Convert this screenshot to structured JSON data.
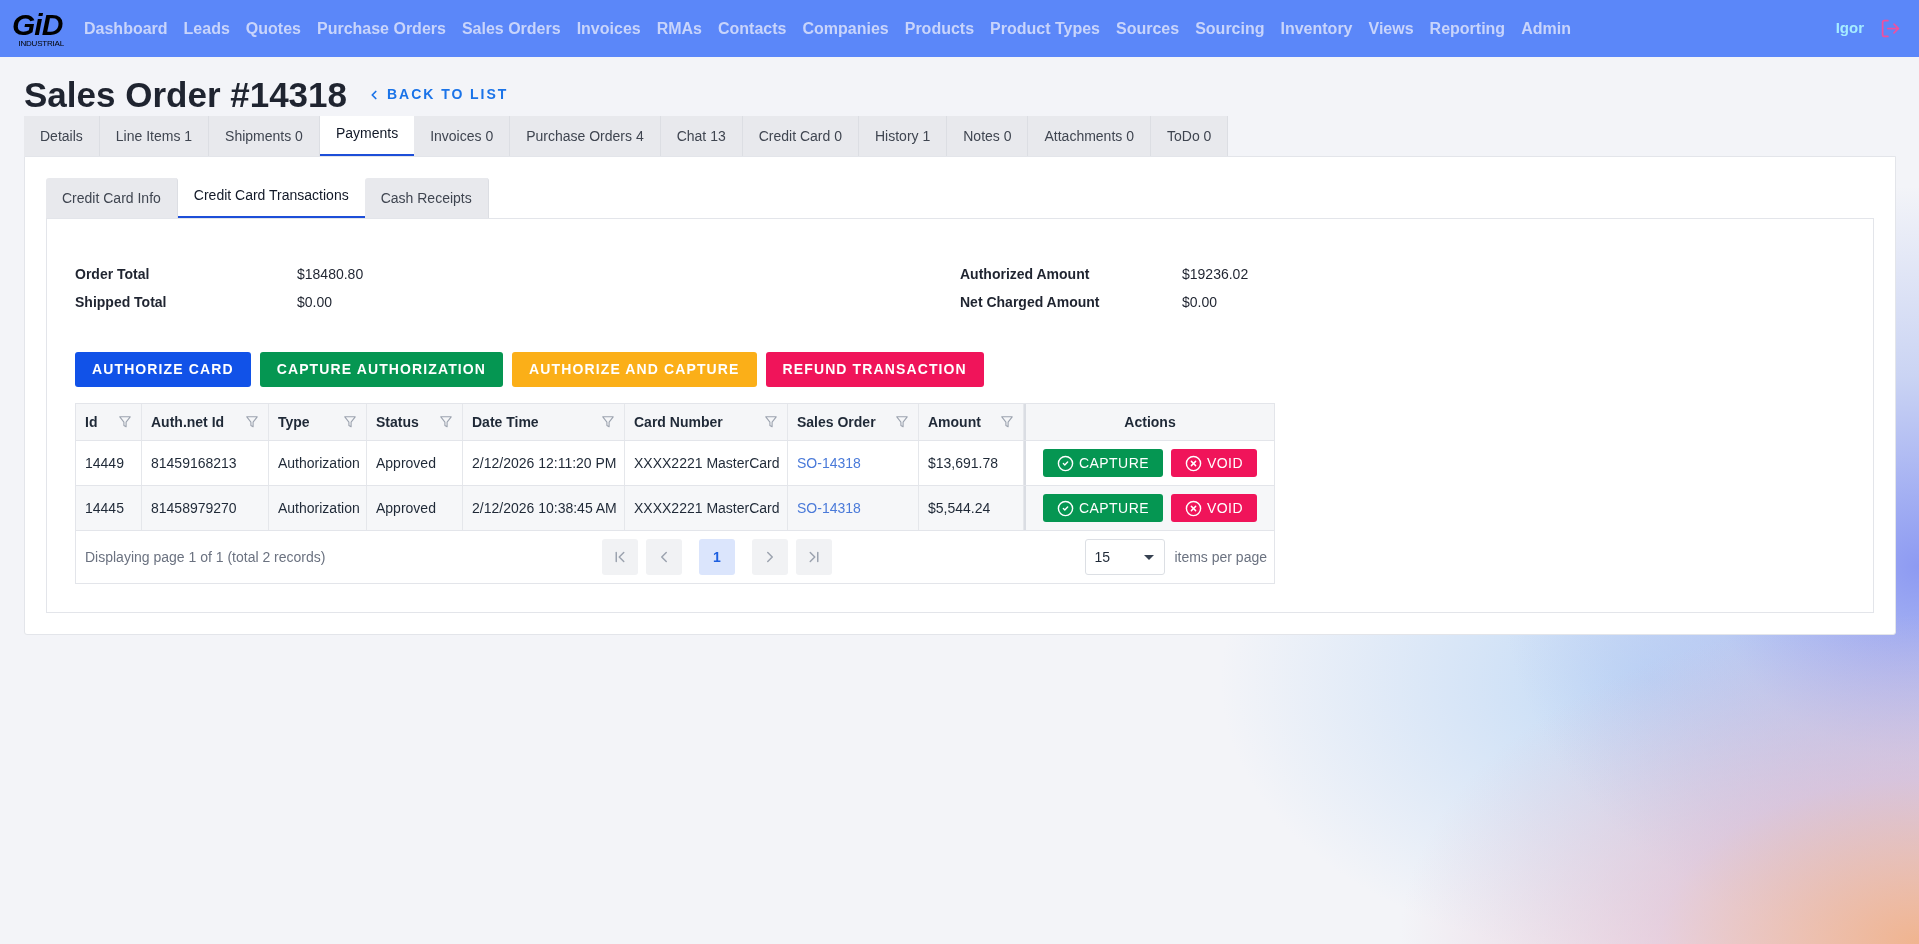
{
  "nav": {
    "logo": {
      "text": "GiD",
      "subtitle": "INDUSTRIAL"
    },
    "items": [
      "Dashboard",
      "Leads",
      "Quotes",
      "Purchase Orders",
      "Sales Orders",
      "Invoices",
      "RMAs",
      "Contacts",
      "Companies",
      "Products",
      "Product Types",
      "Sources",
      "Sourcing",
      "Inventory",
      "Views",
      "Reporting",
      "Admin"
    ],
    "user": "Igor"
  },
  "page": {
    "title": "Sales Order #14318",
    "back_link": "BACK TO LIST"
  },
  "tabs": [
    {
      "label": "Details",
      "selected": false
    },
    {
      "label": "Line Items 1",
      "selected": false
    },
    {
      "label": "Shipments 0",
      "selected": false
    },
    {
      "label": "Payments",
      "selected": true
    },
    {
      "label": "Invoices 0",
      "selected": false
    },
    {
      "label": "Purchase Orders 4",
      "selected": false
    },
    {
      "label": "Chat 13",
      "selected": false
    },
    {
      "label": "Credit Card 0",
      "selected": false
    },
    {
      "label": "History 1",
      "selected": false
    },
    {
      "label": "Notes 0",
      "selected": false
    },
    {
      "label": "Attachments 0",
      "selected": false
    },
    {
      "label": "ToDo 0",
      "selected": false
    }
  ],
  "sub_tabs": [
    {
      "label": "Credit Card Info",
      "selected": false
    },
    {
      "label": "Credit Card Transactions",
      "selected": true
    },
    {
      "label": "Cash Receipts",
      "selected": false
    }
  ],
  "summary": {
    "left": [
      {
        "label": "Order Total",
        "value": "$18480.80"
      },
      {
        "label": "Shipped Total",
        "value": "$0.00"
      }
    ],
    "right": [
      {
        "label": "Authorized Amount",
        "value": "$19236.02"
      },
      {
        "label": "Net Charged Amount",
        "value": "$0.00"
      }
    ]
  },
  "actions": [
    {
      "label": "AUTHORIZE CARD",
      "color": "#1152e8"
    },
    {
      "label": "CAPTURE AUTHORIZATION",
      "color": "#059652"
    },
    {
      "label": "AUTHORIZE AND CAPTURE",
      "color": "#fbaf18"
    },
    {
      "label": "REFUND TRANSACTION",
      "color": "#f0145a"
    }
  ],
  "table": {
    "columns": [
      {
        "label": "Id",
        "filterable": true,
        "kind": "text"
      },
      {
        "label": "Auth.net Id",
        "filterable": true,
        "kind": "text"
      },
      {
        "label": "Type",
        "filterable": true,
        "kind": "text"
      },
      {
        "label": "Status",
        "filterable": true,
        "kind": "text"
      },
      {
        "label": "Date Time",
        "filterable": true,
        "kind": "text"
      },
      {
        "label": "Card Number",
        "filterable": true,
        "kind": "text"
      },
      {
        "label": "Sales Order",
        "filterable": true,
        "kind": "link"
      },
      {
        "label": "Amount",
        "filterable": true,
        "kind": "text"
      },
      {
        "label": "Actions",
        "filterable": false,
        "kind": "actions"
      }
    ],
    "rows": [
      {
        "cells": [
          "14449",
          "81459168213",
          "Authorization",
          "Approved",
          "2/12/2026 12:11:20 PM",
          "XXXX2221 MasterCard",
          "SO-14318",
          "$13,691.78"
        ],
        "actions": [
          {
            "label": "CAPTURE",
            "kind": "capture"
          },
          {
            "label": "VOID",
            "kind": "void"
          }
        ]
      },
      {
        "cells": [
          "14445",
          "81458979270",
          "Authorization",
          "Approved",
          "2/12/2026 10:38:45 AM",
          "XXXX2221 MasterCard",
          "SO-14318",
          "$5,544.24"
        ],
        "actions": [
          {
            "label": "CAPTURE",
            "kind": "capture"
          },
          {
            "label": "VOID",
            "kind": "void"
          }
        ]
      }
    ],
    "footer": {
      "summary": "Displaying page 1 of 1 (total 2 records)",
      "pages": [
        {
          "label": "1",
          "selected": true
        }
      ],
      "page_size": "15",
      "page_size_label": "items per page"
    }
  }
}
